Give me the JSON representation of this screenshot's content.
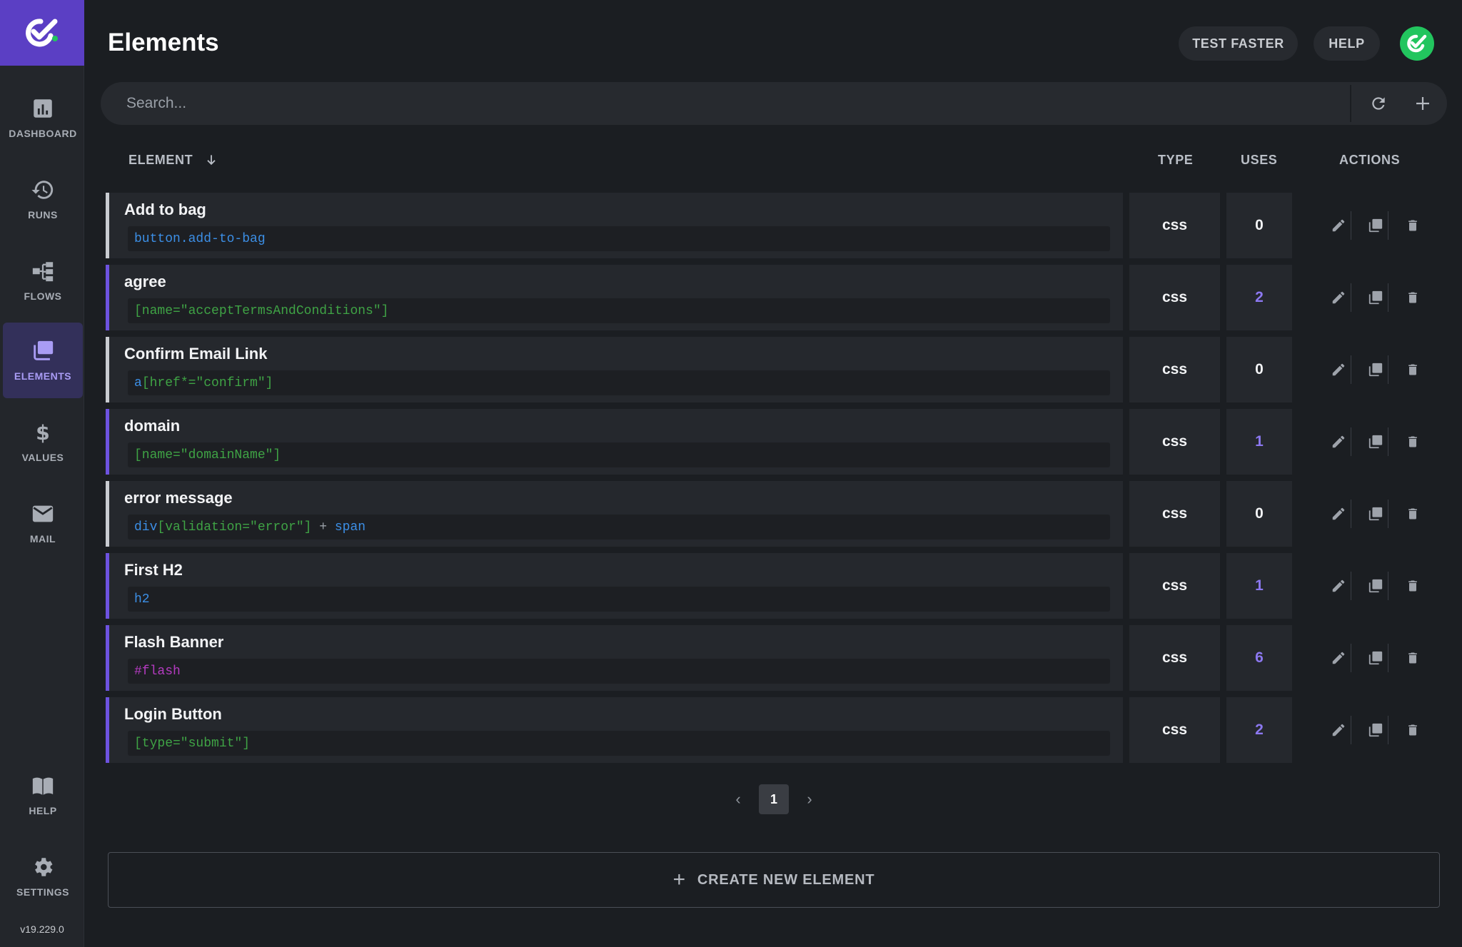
{
  "header": {
    "title": "Elements",
    "test_faster": "TEST FASTER",
    "help": "HELP"
  },
  "sidebar": {
    "items": [
      {
        "label": "DASHBOARD",
        "icon": "bar-chart-icon"
      },
      {
        "label": "RUNS",
        "icon": "history-icon"
      },
      {
        "label": "FLOWS",
        "icon": "flow-icon"
      },
      {
        "label": "ELEMENTS",
        "icon": "elements-icon",
        "active": true
      },
      {
        "label": "VALUES",
        "icon": "dollar-icon"
      },
      {
        "label": "MAIL",
        "icon": "mail-icon"
      },
      {
        "label": "HELP",
        "icon": "book-icon"
      },
      {
        "label": "SETTINGS",
        "icon": "gear-icon"
      }
    ],
    "version": "v19.229.0"
  },
  "search": {
    "placeholder": "Search..."
  },
  "table": {
    "columns": {
      "element": "ELEMENT",
      "type": "TYPE",
      "uses": "USES",
      "actions": "ACTIONS"
    },
    "rows": [
      {
        "name": "Add to bag",
        "selector_parts": [
          {
            "text": "button.add-to-bag",
            "color": "blue"
          }
        ],
        "type": "css",
        "uses": "0"
      },
      {
        "name": "agree",
        "selector_parts": [
          {
            "text": "[name=\"acceptTermsAndConditions\"]",
            "color": "green"
          }
        ],
        "type": "css",
        "uses": "2"
      },
      {
        "name": "Confirm Email Link",
        "selector_parts": [
          {
            "text": "a",
            "color": "blue"
          },
          {
            "text": "[href*=\"confirm\"]",
            "color": "green"
          }
        ],
        "type": "css",
        "uses": "0"
      },
      {
        "name": "domain",
        "selector_parts": [
          {
            "text": "[name=\"domainName\"]",
            "color": "green"
          }
        ],
        "type": "css",
        "uses": "1"
      },
      {
        "name": "error message",
        "selector_parts": [
          {
            "text": "div",
            "color": "blue"
          },
          {
            "text": "[validation=\"error\"]",
            "color": "green"
          },
          {
            "text": " + ",
            "color": "grey"
          },
          {
            "text": "span",
            "color": "blue"
          }
        ],
        "type": "css",
        "uses": "0"
      },
      {
        "name": "First H2",
        "selector_parts": [
          {
            "text": "h2",
            "color": "blue"
          }
        ],
        "type": "css",
        "uses": "1"
      },
      {
        "name": "Flash Banner",
        "selector_parts": [
          {
            "text": "#flash",
            "color": "purple"
          }
        ],
        "type": "css",
        "uses": "6"
      },
      {
        "name": "Login Button",
        "selector_parts": [
          {
            "text": "[type=\"submit\"]",
            "color": "green"
          }
        ],
        "type": "css",
        "uses": "2"
      }
    ]
  },
  "pagination": {
    "current": "1",
    "prev": "‹",
    "next": "›"
  },
  "create_button": {
    "label": "CREATE NEW ELEMENT"
  },
  "colors": {
    "accent": "#5b3fc4",
    "uses_highlight": "#8c78f0",
    "selector_blue": "#3c8fe6",
    "selector_green": "#3fa345",
    "selector_purple": "#b43bc0",
    "avatar_green": "#22c55e"
  }
}
